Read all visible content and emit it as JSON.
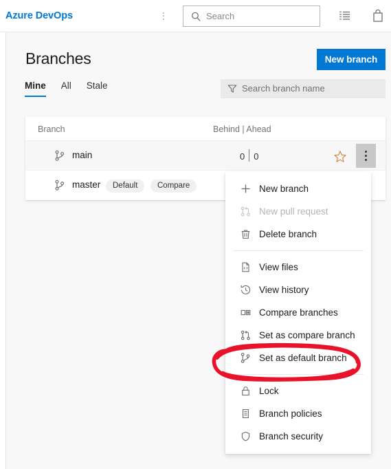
{
  "topbar": {
    "brand": "Azure DevOps",
    "more_icon": "more-vertical-icon",
    "search": {
      "placeholder": "Search",
      "icon": "search-icon"
    },
    "icons": [
      {
        "name": "list-icon",
        "label": "Work items"
      },
      {
        "name": "marketplace-bag-icon",
        "label": "Marketplace"
      }
    ]
  },
  "page": {
    "title": "Branches",
    "new_branch_button": "New branch",
    "tabs": [
      {
        "label": "Mine",
        "active": true
      },
      {
        "label": "All",
        "active": false
      },
      {
        "label": "Stale",
        "active": false
      }
    ],
    "filter": {
      "placeholder": "Search branch name",
      "icon": "filter-funnel-icon"
    }
  },
  "table": {
    "headers": {
      "branch": "Branch",
      "behind_ahead": "Behind | Ahead"
    },
    "rows": [
      {
        "name": "main",
        "icon": "branch-icon",
        "behind": "0",
        "ahead": "0",
        "separator": "|",
        "badges": [],
        "favorite_icon": "star-outline-icon",
        "menu_icon": "more-vertical-icon",
        "hovered": true
      },
      {
        "name": "master",
        "icon": "branch-icon",
        "behind": "",
        "ahead": "",
        "badges": [
          "Default",
          "Compare"
        ],
        "hovered": false
      }
    ]
  },
  "context_menu": {
    "items": [
      {
        "label": "New branch",
        "icon": "plus-icon",
        "disabled": false,
        "separator_after": false
      },
      {
        "label": "New pull request",
        "icon": "pull-request-icon",
        "disabled": true,
        "separator_after": false
      },
      {
        "label": "Delete branch",
        "icon": "trash-icon",
        "disabled": false,
        "separator_after": true
      },
      {
        "label": "View files",
        "icon": "file-code-icon",
        "disabled": false,
        "separator_after": false
      },
      {
        "label": "View history",
        "icon": "history-clock-icon",
        "disabled": false,
        "separator_after": false
      },
      {
        "label": "Compare branches",
        "icon": "compare-columns-icon",
        "disabled": false,
        "separator_after": false
      },
      {
        "label": "Set as compare branch",
        "icon": "pull-request-icon",
        "disabled": false,
        "separator_after": false
      },
      {
        "label": "Set as default branch",
        "icon": "branch-icon",
        "disabled": false,
        "separator_after": true
      },
      {
        "label": "Lock",
        "icon": "lock-icon",
        "disabled": false,
        "separator_after": false
      },
      {
        "label": "Branch policies",
        "icon": "policy-icon",
        "disabled": false,
        "separator_after": false
      },
      {
        "label": "Branch security",
        "icon": "shield-icon",
        "disabled": false,
        "separator_after": false
      }
    ]
  },
  "annotation": {
    "type": "hand-drawn-ellipse",
    "color": "#e8132a",
    "targets": "Set as default branch"
  }
}
